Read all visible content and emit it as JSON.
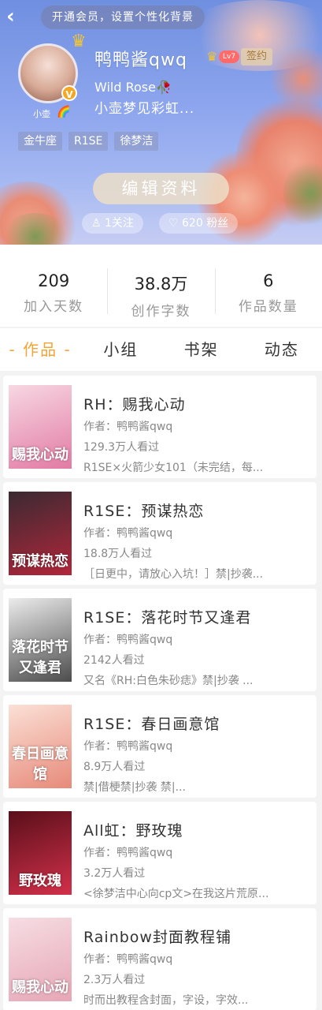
{
  "header": {
    "vip_banner": "开通会员，设置个性化背景",
    "avatar_caption": "小壶",
    "username": "鸭鸭酱qwq",
    "level": "Lv7",
    "sign_badge": "签约",
    "signature_line1": "Wild Rose🥀",
    "signature_line2": "小壶梦见彩虹...",
    "tags": [
      "金牛座",
      "R1SE",
      "徐梦洁"
    ],
    "edit_button": "编辑资料",
    "following": "1关注",
    "fans": "620 粉丝"
  },
  "stats": [
    {
      "value": "209",
      "label": "加入天数"
    },
    {
      "value": "38.8万",
      "label": "创作字数"
    },
    {
      "value": "6",
      "label": "作品数量"
    }
  ],
  "tabs": [
    {
      "label": "- 作品 -",
      "active": true
    },
    {
      "label": "小组",
      "active": false
    },
    {
      "label": "书架",
      "active": false
    },
    {
      "label": "动态",
      "active": false
    }
  ],
  "works": [
    {
      "title": "RH：赐我心动",
      "author": "作者：鸭鸭酱qwq",
      "views": "129.3万人看过",
      "desc": "R1SE×火箭少女101（未完结，每...",
      "cover_text": "赐我心动",
      "cover_colors": [
        "#f7d7e2",
        "#e27ba4"
      ]
    },
    {
      "title": "R1SE：预谋热恋",
      "author": "作者：鸭鸭酱qwq",
      "views": "18.8万人看过",
      "desc": "［日更中，请放心入坑！］禁|抄袭...",
      "cover_text": "预谋热恋",
      "cover_colors": [
        "#3a2a32",
        "#b2263a"
      ]
    },
    {
      "title": "R1SE：落花时节又逢君",
      "author": "作者：鸭鸭酱qwq",
      "views": "2142人看过",
      "desc": "又名《RH:白色朱砂痣》禁|抄袭 ...",
      "cover_text": "落花时节又逢君",
      "cover_colors": [
        "#ececec",
        "#4c4c4c"
      ]
    },
    {
      "title": "R1SE：春日画意馆",
      "author": "作者：鸭鸭酱qwq",
      "views": "8.9万人看过",
      "desc": "禁|借梗禁|抄袭 禁|...",
      "cover_text": "春日画意馆",
      "cover_colors": [
        "#fbe0d6",
        "#e78a7a"
      ]
    },
    {
      "title": "All虹：野玫瑰",
      "author": "作者：鸭鸭酱qwq",
      "views": "3.2万人看过",
      "desc": "<徐梦洁中心向cp文>在我这片荒原...",
      "cover_text": "野玫瑰",
      "cover_colors": [
        "#5a0f1a",
        "#d2304a"
      ]
    },
    {
      "title": "Rainbow封面教程铺",
      "author": "作者：鸭鸭酱qwq",
      "views": "2.3万人看过",
      "desc": "时而出教程含封面，字设，字效...",
      "cover_text": "赐我心动",
      "cover_colors": [
        "#f6dde3",
        "#e6a6b6"
      ]
    }
  ],
  "colors": {
    "accent": "#f2a535",
    "level_badge": "#ff6b6b"
  }
}
